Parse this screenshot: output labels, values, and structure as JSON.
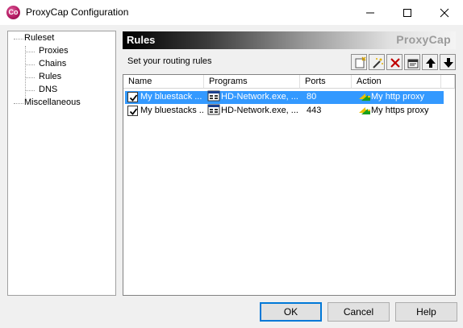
{
  "window": {
    "title": "ProxyCap Configuration",
    "icon_label": "Co",
    "controls": {
      "minimize": "minimize-icon",
      "maximize": "maximize-icon",
      "close": "close-icon"
    }
  },
  "tree": {
    "items": [
      {
        "label": "Ruleset"
      },
      {
        "label": "Proxies"
      },
      {
        "label": "Chains"
      },
      {
        "label": "Rules"
      },
      {
        "label": "DNS"
      },
      {
        "label": "Miscellaneous"
      }
    ]
  },
  "panel": {
    "title": "Rules",
    "brand": "ProxyCap",
    "subtitle": "Set your routing rules",
    "toolbar": [
      "new-rule-icon",
      "wizard-icon",
      "delete-icon",
      "properties-icon",
      "move-up-icon",
      "move-down-icon"
    ]
  },
  "table": {
    "columns": [
      "Name",
      "Programs",
      "Ports",
      "Action"
    ],
    "rows": [
      {
        "checked": true,
        "name": "My bluestack ...",
        "programs": "HD-Network.exe, ...",
        "ports": "80",
        "action": "My http proxy",
        "selected": true
      },
      {
        "checked": true,
        "name": "My bluestacks ...",
        "programs": "HD-Network.exe, ...",
        "ports": "443",
        "action": "My https proxy",
        "selected": false
      }
    ]
  },
  "buttons": {
    "ok": "OK",
    "cancel": "Cancel",
    "help": "Help"
  },
  "colors": {
    "selection": "#3399ff",
    "accent": "#0078d7"
  }
}
